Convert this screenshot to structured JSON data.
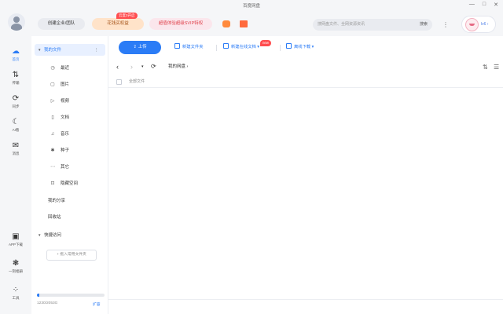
{
  "window": {
    "title": "百度网盘",
    "controls": [
      "—",
      "□",
      "✕"
    ]
  },
  "header": {
    "org_button": "创建企业/团队",
    "vip_button": "花钱买权益",
    "vip_badge": "云度2开启",
    "promo_button": "超值体验超级SVIP特权",
    "search_placeholder": "搜网盘文件、全网资源资讯",
    "search_button": "搜索",
    "more": "⋮",
    "user_level": "lv6 ›"
  },
  "rail": {
    "items": [
      {
        "label": "首页",
        "icon": "home-icon",
        "glyph": "☁",
        "active": true
      },
      {
        "label": "传输",
        "icon": "transfer-icon",
        "glyph": "⇅",
        "active": false
      },
      {
        "label": "同步",
        "icon": "sync-icon",
        "glyph": "⟳",
        "active": false
      },
      {
        "label": "AI看",
        "icon": "ai-icon",
        "glyph": "☾",
        "active": false
      },
      {
        "label": "消息",
        "icon": "message-icon",
        "glyph": "✉",
        "active": false
      }
    ],
    "bottom": [
      {
        "label": "APP下载",
        "icon": "phone-icon",
        "glyph": "▣"
      },
      {
        "label": "一刻相册",
        "icon": "album-icon",
        "glyph": "❃"
      },
      {
        "label": "工具",
        "icon": "tools-icon",
        "glyph": "⁘"
      }
    ]
  },
  "sidebar": {
    "my_files": "我的文件",
    "more": "⋮",
    "categories": [
      {
        "label": "最近",
        "icon": "clock-icon",
        "glyph": "◷"
      },
      {
        "label": "图片",
        "icon": "image-icon",
        "glyph": "▢"
      },
      {
        "label": "视频",
        "icon": "video-icon",
        "glyph": "▷"
      },
      {
        "label": "文档",
        "icon": "document-icon",
        "glyph": "▯"
      },
      {
        "label": "音乐",
        "icon": "music-icon",
        "glyph": "♫"
      },
      {
        "label": "种子",
        "icon": "seed-icon",
        "glyph": "✱"
      },
      {
        "label": "其它",
        "icon": "other-icon",
        "glyph": "⋯"
      },
      {
        "label": "隐藏空间",
        "icon": "lock-icon",
        "glyph": "⊡"
      }
    ],
    "my_share": "我的分享",
    "recycle": "回收站",
    "quick_access": "快捷访问",
    "add_quick": "+ 拖入常用文件夹",
    "quota_text": "1230/2053G",
    "quota_percent": 4,
    "expand": "扩容"
  },
  "toolbar": {
    "upload": "上传",
    "new_folder": "新建文件夹",
    "new_online_doc": "新建在线文档 ▾",
    "new_badge": "new",
    "offline_download": "离线下载 ▾",
    "sort_icon": "⇅",
    "view_icon": "☰"
  },
  "navigation": {
    "back": "‹",
    "forward": "›",
    "dropdown": "▾",
    "refresh": "⟳",
    "breadcrumb": "我的网盘 ›"
  },
  "list": {
    "header_label": "全部文件"
  },
  "colors": {
    "accent": "#2b7cf6",
    "vip": "#ffe3c9",
    "promo": "#fbe6ec"
  }
}
